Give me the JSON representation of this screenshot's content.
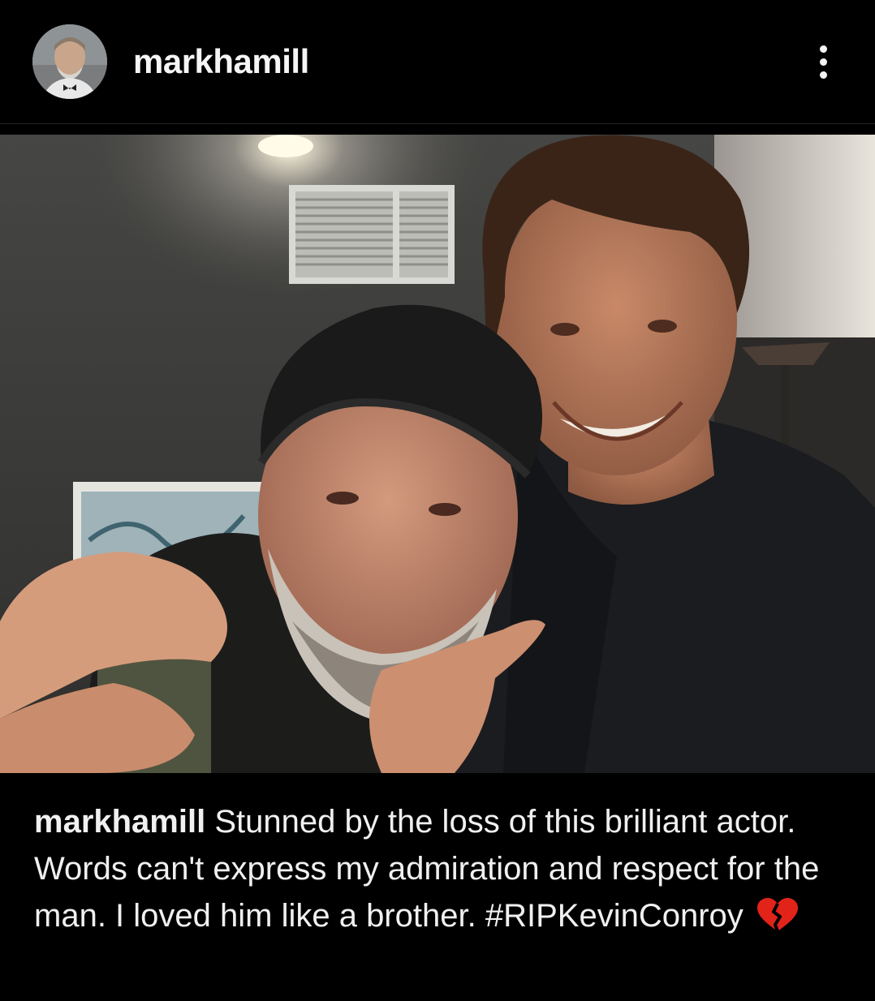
{
  "header": {
    "username": "markhamill",
    "avatar_icon": "profile-avatar",
    "more_icon": "more-vertical-icon"
  },
  "post": {
    "photo_icon": "post-photo"
  },
  "caption": {
    "username": "markhamill",
    "text": "Stunned by the loss of this brilliant actor. Words can't express my admiration and respect for the man. I loved him like a brother.",
    "hashtag": "#RIPKevinConroy",
    "emoji_icon": "broken-heart-icon"
  },
  "colors": {
    "background": "#000000",
    "text": "#f5f5f5",
    "divider": "#262626",
    "heart": "#e2231a"
  }
}
